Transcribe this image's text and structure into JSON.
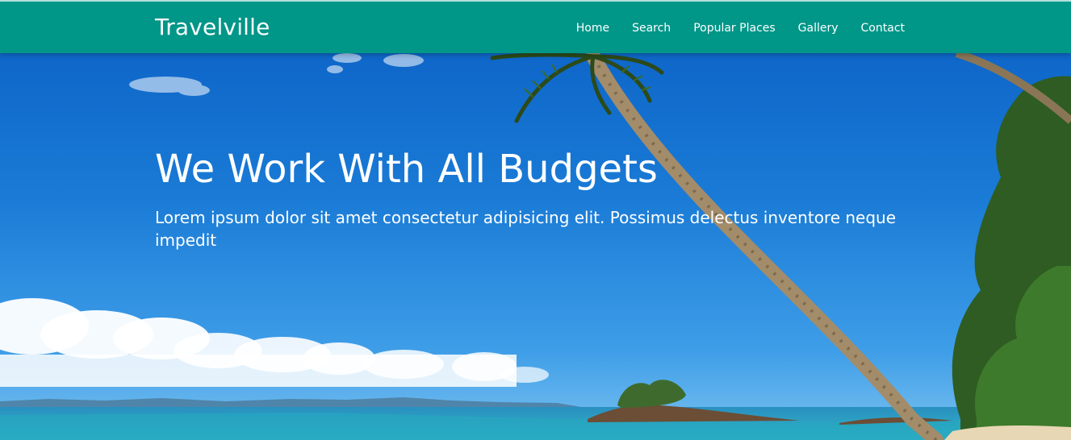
{
  "navbar": {
    "brand": "Travelville",
    "links": [
      {
        "label": "Home"
      },
      {
        "label": "Search"
      },
      {
        "label": "Popular Places"
      },
      {
        "label": "Gallery"
      },
      {
        "label": "Contact"
      }
    ]
  },
  "hero": {
    "title": "We Work With All Budgets",
    "text": "Lorem ipsum dolor sit amet consectetur adipisicing elit. Possimus delectus inventore neque impedit",
    "image": "tropical-beach-palm-tree"
  },
  "colors": {
    "navbar_bg": "#009688",
    "text": "#ffffff",
    "sky": "#1a78d4",
    "sea": "#1fa3c4"
  }
}
